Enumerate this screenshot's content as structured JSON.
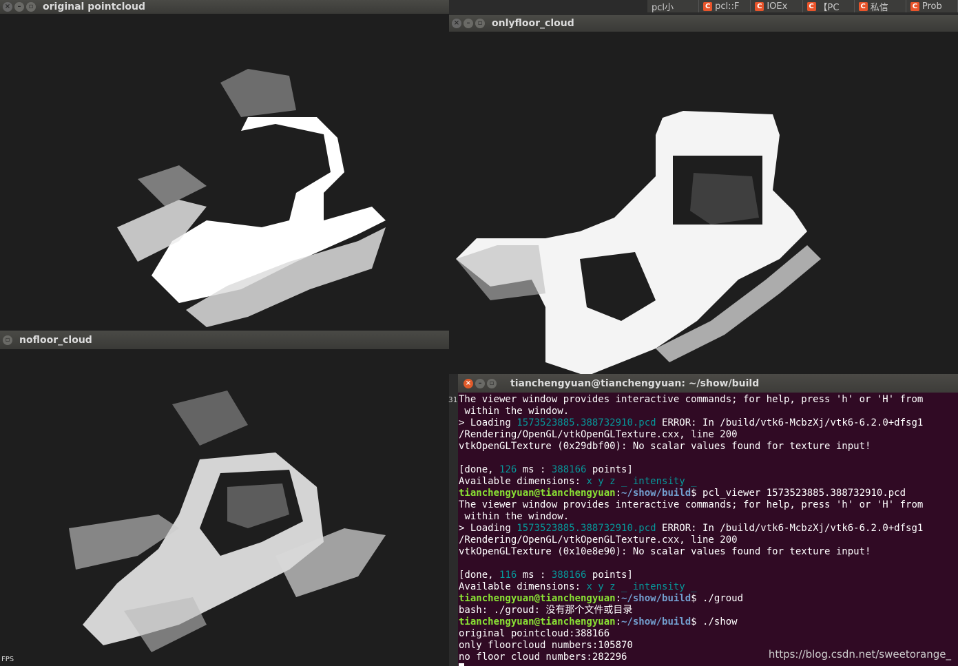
{
  "windows": {
    "original": {
      "title": "original pointcloud"
    },
    "onlyfloor": {
      "title": "onlyfloor_cloud"
    },
    "nofloor": {
      "title": "nofloor_cloud",
      "fps_label": "FPS"
    }
  },
  "browser_tabs": [
    {
      "label": "pcl小"
    },
    {
      "label": "pcl::F"
    },
    {
      "label": "IOEx"
    },
    {
      "label": "【PC"
    },
    {
      "label": "私信"
    },
    {
      "label": "Prob"
    }
  ],
  "terminal": {
    "title": "tianchengyuan@tianchengyuan: ~/show/build",
    "gutter": "31",
    "prompt_user": "tianchengyuan@tianchengyuan",
    "prompt_path": "~/show/build",
    "lines": {
      "l1": "The viewer window provides interactive commands; for help, press 'h' or 'H' from",
      "l2": " within the window.",
      "loading_prefix": "> Loading ",
      "pcd_file": "1573523885.388732910.pcd",
      "error_a": " ERROR: In /build/vtk6-McbzXj/vtk6-6.2.0+dfsg1",
      "error_b": "/Rendering/OpenGL/vtkOpenGLTexture.cxx, line 200",
      "vtk1": "vtkOpenGLTexture (0x29dbf00): No scalar values found for texture input!",
      "done1_a": "[done, ",
      "done1_ms": "126",
      "done1_b": " ms : ",
      "done1_pts": "388166",
      "done1_c": " points]",
      "avail": "Available dimensions: ",
      "dims": "x y z _ intensity _",
      "cmd1": "$ pcl_viewer 1573523885.388732910.pcd",
      "vtk2": "vtkOpenGLTexture (0x10e8e90): No scalar values found for texture input!",
      "done2_ms": "116",
      "cmd2": "$ ./groud",
      "bash_err": "bash: ./groud: 没有那个文件或目录",
      "cmd3": "$ ./show",
      "out1": "original pointcloud:388166",
      "out2": "only floorcloud numbers:105870",
      "out3": "no floor cloud numbers:282296"
    }
  },
  "watermark": "https://blog.csdn.net/sweetorange_"
}
